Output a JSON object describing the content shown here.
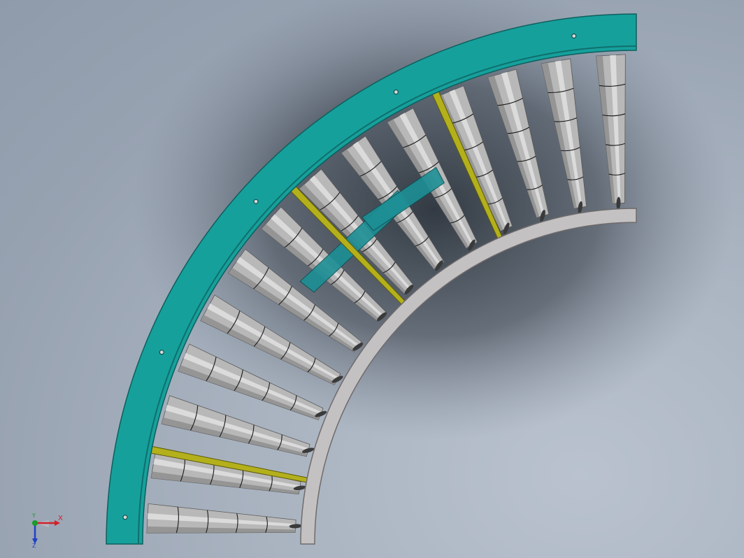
{
  "view": {
    "background_colors": [
      "#b9c2ce",
      "#97a2b1"
    ]
  },
  "conveyor": {
    "type": "curved roller conveyor, 90 degree",
    "roller_count": 14,
    "roller_segments": 4,
    "colors": {
      "outer_frame": "#16a09c",
      "outer_frame_edge": "#0d5f5c",
      "inner_frame": "#c4c1c2",
      "inner_frame_edge": "#6f6b6c",
      "roller_light": "#e0e0e0",
      "roller_mid": "#b8b8b8",
      "roller_dark": "#8c8c8c",
      "cross_brace": "#b3b01c",
      "bracket": "#1c8f95"
    }
  },
  "triad": {
    "x_label": "X",
    "y_label": "Y",
    "z_label": "Z",
    "x_color": "#d2202a",
    "y_color": "#1a9c2a",
    "z_color": "#2040c8"
  }
}
